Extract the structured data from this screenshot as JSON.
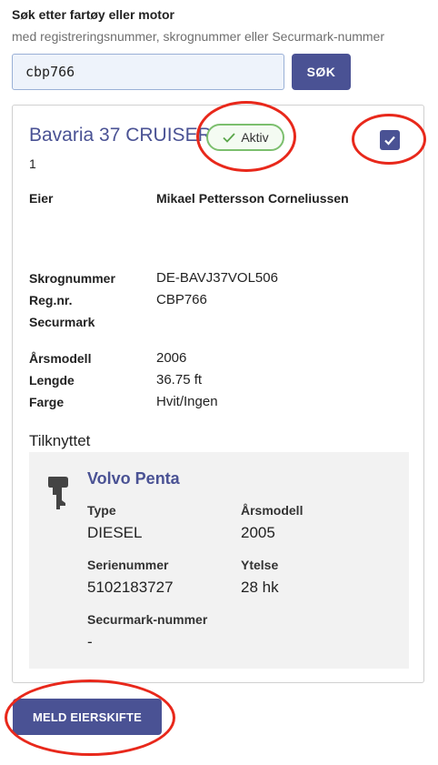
{
  "search": {
    "label": "Søk etter fartøy eller motor",
    "help": "med registreringsnummer, skrognummer eller Securmark-nummer",
    "value": "cbp766",
    "button_label": "SØK"
  },
  "vessel": {
    "name": "Bavaria 37 CRUISER",
    "status": "Aktiv",
    "sub": "1",
    "selected": true,
    "fields": {
      "owner_label": "Eier",
      "owner_value": "Mikael Pettersson Corneliussen",
      "hull_label": "Skrognummer",
      "hull_value": "DE-BAVJ37VOL506",
      "reg_label": "Reg.nr.",
      "reg_value": "CBP766",
      "securmark_label": "Securmark",
      "year_label": "Årsmodell",
      "year_value": "2006",
      "length_label": "Lengde",
      "length_value": "36.75 ft",
      "color_label": "Farge",
      "color_value": "Hvit/Ingen"
    }
  },
  "attached": {
    "title": "Tilknyttet",
    "engine": {
      "icon": "outboard-motor-icon",
      "name": "Volvo Penta",
      "type_label": "Type",
      "type_value": "DIESEL",
      "year_label": "Årsmodell",
      "year_value": "2005",
      "serial_label": "Serienummer",
      "serial_value": "5102183727",
      "power_label": "Ytelse",
      "power_value": "28 hk",
      "securmark_label": "Securmark-nummer",
      "securmark_value": "-"
    }
  },
  "actions": {
    "transfer_label": "MELD EIERSKIFTE"
  },
  "colors": {
    "accent": "#4a5294",
    "status_border": "#7cbf6e",
    "annotation_red": "#e8281b"
  }
}
